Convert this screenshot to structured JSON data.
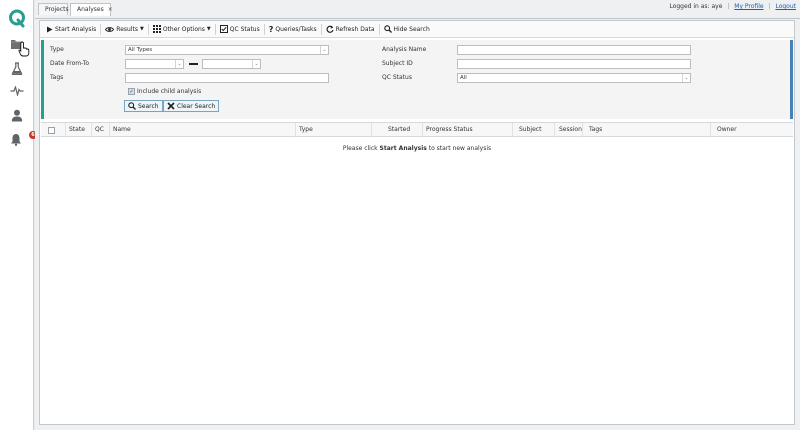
{
  "sidebar": {
    "logo_letter": "Q",
    "items": [
      {
        "name": "projects",
        "icon": "folder-icon"
      },
      {
        "name": "lab",
        "icon": "flask-icon"
      },
      {
        "name": "signals",
        "icon": "pulse-icon"
      },
      {
        "name": "subjects",
        "icon": "person-icon"
      },
      {
        "name": "notifications",
        "icon": "bell-icon",
        "badge": "6"
      }
    ]
  },
  "tabs": [
    {
      "label": "Projects",
      "active": false
    },
    {
      "label": "Analyses",
      "active": true,
      "close": "×"
    }
  ],
  "user": {
    "logged_in_text": "Logged in as: aye",
    "profile_link": "My Profile",
    "logout_link": "Logout",
    "separator": "|"
  },
  "toolbar": {
    "start_analysis": "Start Analysis",
    "results": "Results",
    "other_options": "Other Options",
    "qc_status": "QC Status",
    "queries_tasks": "Queries/Tasks",
    "refresh_data": "Refresh Data",
    "hide_search": "Hide Search"
  },
  "search": {
    "type_label": "Type",
    "type_value": "All Types",
    "date_label": "Date From-To",
    "date_from": "",
    "date_to": "",
    "tags_label": "Tags",
    "tags_value": "",
    "include_child_label": "Include child analysis",
    "include_child_checked": true,
    "analysis_name_label": "Analysis Name",
    "analysis_name_value": "",
    "subject_id_label": "Subject ID",
    "subject_id_value": "",
    "qc_status_label": "QC Status",
    "qc_status_value": "All",
    "search_button": "Search",
    "clear_button": "Clear Search"
  },
  "grid": {
    "columns": [
      "State",
      "QC",
      "Name",
      "Type",
      "Started",
      "Progress Status",
      "Subject",
      "Session",
      "Tags",
      "Owner"
    ],
    "empty_prefix": "Please click ",
    "empty_bold": "Start Analysis",
    "empty_suffix": " to start new analysis"
  },
  "colors": {
    "brand_teal": "#2a9d8f",
    "search_border_right": "#4682b4",
    "badge_red": "#c0392b",
    "link_blue": "#1a5fb4"
  }
}
